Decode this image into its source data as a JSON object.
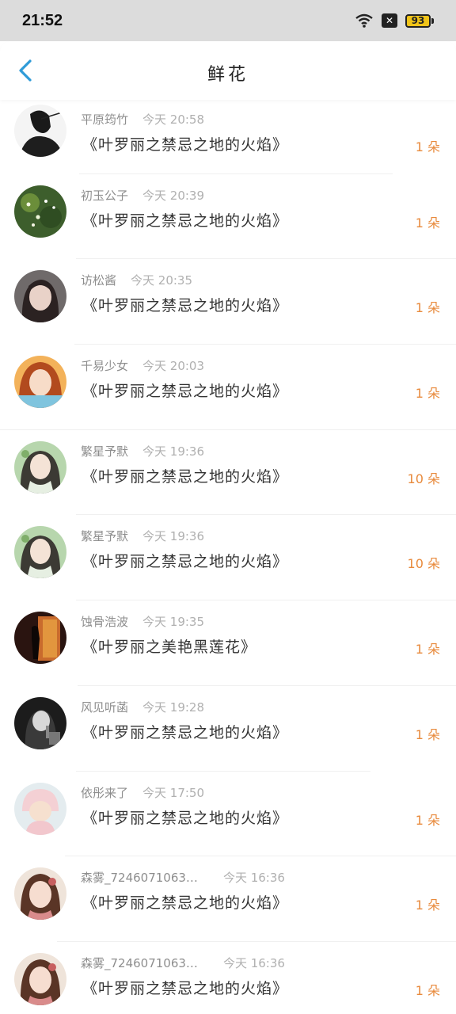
{
  "status": {
    "time": "21:52",
    "x_label": "✕",
    "battery": "93"
  },
  "header": {
    "title": "鲜花",
    "back_icon": "chevron-left-icon"
  },
  "colors": {
    "accent": "#2f9bd8",
    "count": "#e88a3c",
    "status_bg": "#dcdcdc",
    "battery": "#f0c419"
  },
  "records": [
    {
      "user": "平原筠竹",
      "time": "今天 20:58",
      "gift": "《叶罗丽之禁忌之地的火焰》",
      "count": "1 朵",
      "avatar": "ink-figure-avatar"
    },
    {
      "user": "初玉公子",
      "time": "今天 20:39",
      "gift": "《叶罗丽之禁忌之地的火焰》",
      "count": "1 朵",
      "avatar": "green-sparkle-avatar"
    },
    {
      "user": "访松酱",
      "time": "今天 20:35",
      "gift": "《叶罗丽之禁忌之地的火焰》",
      "count": "1 朵",
      "avatar": "girl-portrait-avatar"
    },
    {
      "user": "千易少女",
      "time": "今天 20:03",
      "gift": "《叶罗丽之禁忌之地的火焰》",
      "count": "1 朵",
      "avatar": "redhair-girl-avatar"
    },
    {
      "user": "繁星予默",
      "time": "今天 19:36",
      "gift": "《叶罗丽之禁忌之地的火焰》",
      "count": "10 朵",
      "avatar": "anime-green-avatar"
    },
    {
      "user": "繁星予默",
      "time": "今天 19:36",
      "gift": "《叶罗丽之禁忌之地的火焰》",
      "count": "10 朵",
      "avatar": "anime-green-avatar"
    },
    {
      "user": "蚀骨浩波",
      "time": "今天 19:35",
      "gift": "《叶罗丽之美艳黑莲花》",
      "count": "1 朵",
      "avatar": "silhouette-door-avatar"
    },
    {
      "user": "风见听菡",
      "time": "今天 19:28",
      "gift": "《叶罗丽之禁忌之地的火焰》",
      "count": "1 朵",
      "avatar": "bw-singer-avatar"
    },
    {
      "user": "依彤来了",
      "time": "今天 17:50",
      "gift": "《叶罗丽之禁忌之地的火焰》",
      "count": "1 朵",
      "avatar": "baby-hat-avatar"
    },
    {
      "user": "森雾_7246071063…",
      "time": "今天 16:36",
      "gift": "《叶罗丽之禁忌之地的火焰》",
      "count": "1 朵",
      "avatar": "painted-lady-avatar"
    },
    {
      "user": "森雾_7246071063…",
      "time": "今天 16:36",
      "gift": "《叶罗丽之禁忌之地的火焰》",
      "count": "1 朵",
      "avatar": "painted-lady-avatar"
    }
  ]
}
